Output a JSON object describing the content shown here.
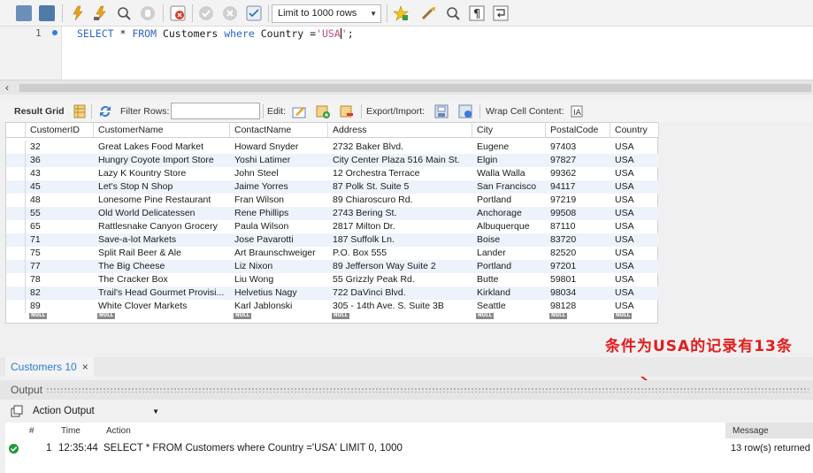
{
  "toolbar": {
    "icons": [
      "open-folder-icon",
      "save-icon",
      "execute-icon",
      "execute-current-icon",
      "explain-icon",
      "stop-icon",
      "toggle-error-icon",
      "commit-icon",
      "rollback-icon",
      "autocommit-icon",
      "bookmark-star-icon",
      "beautify-icon",
      "find-icon",
      "invisible-chars-icon",
      "wrap-icon"
    ],
    "limit_label": "Limit to 1000 rows"
  },
  "editor": {
    "line_number": "1",
    "sql": {
      "t1": "SELECT",
      "t2": " * ",
      "t3": "FROM",
      "t4": " Customers ",
      "t5": "where",
      "t6": " Country =",
      "t7": "'USA",
      "t8": "'",
      "t9": ";"
    }
  },
  "result_toolbar": {
    "result_grid": "Result Grid",
    "filter_rows": "Filter Rows:",
    "edit": "Edit:",
    "export_import": "Export/Import:",
    "wrap_cell": "Wrap Cell Content:"
  },
  "grid": {
    "columns": [
      "CustomerID",
      "CustomerName",
      "ContactName",
      "Address",
      "City",
      "PostalCode",
      "Country"
    ],
    "rows": [
      [
        "32",
        "Great Lakes Food Market",
        "Howard Snyder",
        "2732 Baker Blvd.",
        "Eugene",
        "97403",
        "USA"
      ],
      [
        "36",
        "Hungry Coyote Import Store",
        "Yoshi Latimer",
        "City Center Plaza 516 Main St.",
        "Elgin",
        "97827",
        "USA"
      ],
      [
        "43",
        "Lazy K Kountry Store",
        "John Steel",
        "12 Orchestra Terrace",
        "Walla Walla",
        "99362",
        "USA"
      ],
      [
        "45",
        "Let's Stop N Shop",
        "Jaime Yorres",
        "87 Polk St. Suite 5",
        "San Francisco",
        "94117",
        "USA"
      ],
      [
        "48",
        "Lonesome Pine Restaurant",
        "Fran Wilson",
        "89 Chiaroscuro Rd.",
        "Portland",
        "97219",
        "USA"
      ],
      [
        "55",
        "Old World Delicatessen",
        "Rene Phillips",
        "2743 Bering St.",
        "Anchorage",
        "99508",
        "USA"
      ],
      [
        "65",
        "Rattlesnake Canyon Grocery",
        "Paula Wilson",
        "2817 Milton Dr.",
        "Albuquerque",
        "87110",
        "USA"
      ],
      [
        "71",
        "Save-a-lot Markets",
        "Jose Pavarotti",
        "187 Suffolk Ln.",
        "Boise",
        "83720",
        "USA"
      ],
      [
        "75",
        "Split Rail Beer & Ale",
        "Art Braunschweiger",
        "P.O. Box 555",
        "Lander",
        "82520",
        "USA"
      ],
      [
        "77",
        "The Big Cheese",
        "Liz Nixon",
        "89 Jefferson Way Suite 2",
        "Portland",
        "97201",
        "USA"
      ],
      [
        "78",
        "The Cracker Box",
        "Liu Wong",
        "55 Grizzly Peak Rd.",
        "Butte",
        "59801",
        "USA"
      ],
      [
        "82",
        "Trail's Head Gourmet Provisi...",
        "Helvetius Nagy",
        "722 DaVinci Blvd.",
        "Kirkland",
        "98034",
        "USA"
      ],
      [
        "89",
        "White Clover Markets",
        "Karl Jablonski",
        "305 - 14th Ave. S. Suite 3B",
        "Seattle",
        "98128",
        "USA"
      ]
    ],
    "null_label": "NULL"
  },
  "result_tab": {
    "label": "Customers 10",
    "close": "×"
  },
  "output": {
    "title": "Output",
    "selector": "Action Output",
    "headers": {
      "num": "#",
      "time": "Time",
      "action": "Action",
      "message": "Message"
    },
    "row": {
      "num": "1",
      "time": "12:35:44",
      "action": "SELECT * FROM Customers where Country ='USA' LIMIT 0, 1000",
      "message": "13 row(s) returned"
    }
  },
  "annotation": {
    "text": "条件为USA的记录有13条",
    "color": "#e01d1d"
  },
  "colors": {
    "keyword": "#2b65c7",
    "string": "#c24a8c",
    "tab_accent": "#2b7bd3",
    "success": "#1f9a3a"
  }
}
